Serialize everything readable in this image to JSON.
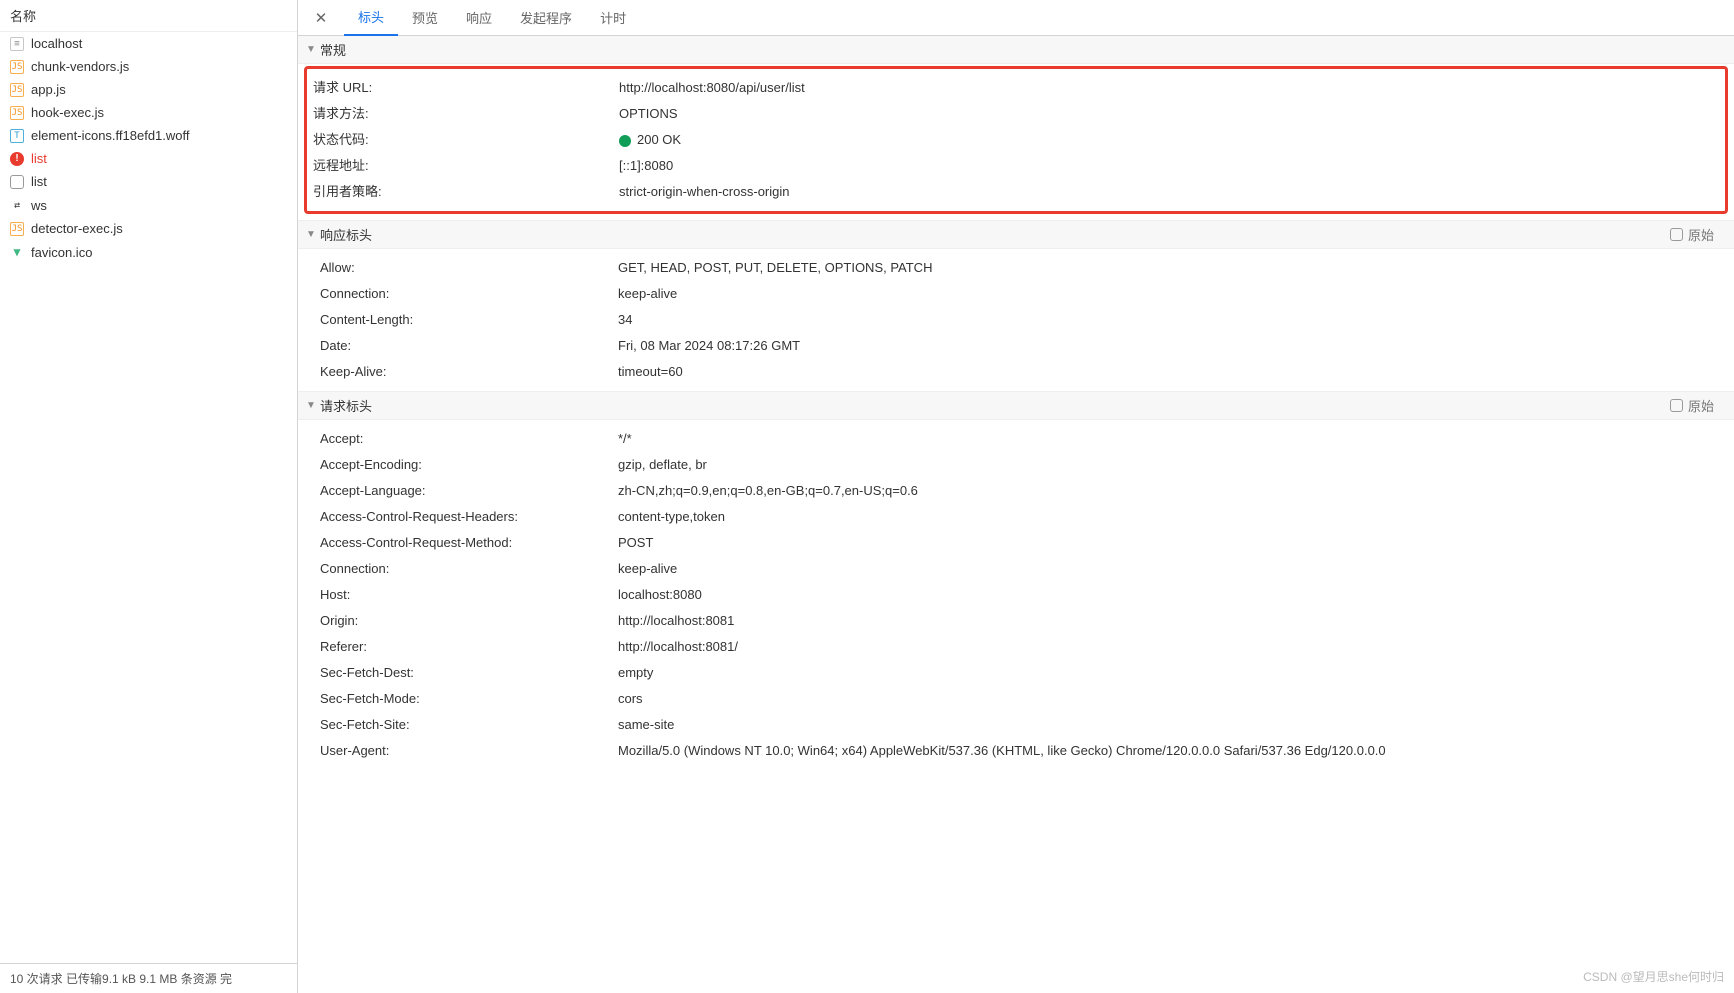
{
  "sidebar": {
    "header": "名称",
    "items": [
      {
        "name": "localhost",
        "iconType": "doc",
        "glyph": "≡"
      },
      {
        "name": "chunk-vendors.js",
        "iconType": "js",
        "glyph": "JS"
      },
      {
        "name": "app.js",
        "iconType": "js",
        "glyph": "JS"
      },
      {
        "name": "hook-exec.js",
        "iconType": "js",
        "glyph": "JS"
      },
      {
        "name": "element-icons.ff18efd1.woff",
        "iconType": "font",
        "glyph": "T"
      },
      {
        "name": "list",
        "iconType": "err",
        "glyph": "!",
        "error": true
      },
      {
        "name": "list",
        "iconType": "empty",
        "glyph": ""
      },
      {
        "name": "ws",
        "iconType": "ws",
        "glyph": "⇄"
      },
      {
        "name": "detector-exec.js",
        "iconType": "js",
        "glyph": "JS"
      },
      {
        "name": "favicon.ico",
        "iconType": "fav",
        "glyph": "▼"
      }
    ],
    "statusBar": "10 次请求  已传输9.1 kB  9.1 MB 条资源  完"
  },
  "tabs": {
    "items": [
      "标头",
      "预览",
      "响应",
      "发起程序",
      "计时"
    ],
    "activeIndex": 0
  },
  "sections": {
    "generalTitle": "常规",
    "responseTitle": "响应标头",
    "requestTitle": "请求标头",
    "rawLabel": "原始"
  },
  "general": [
    {
      "k": "请求 URL:",
      "v": "http://localhost:8080/api/user/list"
    },
    {
      "k": "请求方法:",
      "v": "OPTIONS"
    },
    {
      "k": "状态代码:",
      "v": "200 OK",
      "statusDot": true
    },
    {
      "k": "远程地址:",
      "v": "[::1]:8080"
    },
    {
      "k": "引用者策略:",
      "v": "strict-origin-when-cross-origin"
    }
  ],
  "responseHeaders": [
    {
      "k": "Allow:",
      "v": "GET, HEAD, POST, PUT, DELETE, OPTIONS, PATCH"
    },
    {
      "k": "Connection:",
      "v": "keep-alive"
    },
    {
      "k": "Content-Length:",
      "v": "34"
    },
    {
      "k": "Date:",
      "v": "Fri, 08 Mar 2024 08:17:26 GMT"
    },
    {
      "k": "Keep-Alive:",
      "v": "timeout=60"
    }
  ],
  "requestHeaders": [
    {
      "k": "Accept:",
      "v": "*/*"
    },
    {
      "k": "Accept-Encoding:",
      "v": "gzip, deflate, br"
    },
    {
      "k": "Accept-Language:",
      "v": "zh-CN,zh;q=0.9,en;q=0.8,en-GB;q=0.7,en-US;q=0.6"
    },
    {
      "k": "Access-Control-Request-Headers:",
      "v": "content-type,token"
    },
    {
      "k": "Access-Control-Request-Method:",
      "v": "POST"
    },
    {
      "k": "Connection:",
      "v": "keep-alive"
    },
    {
      "k": "Host:",
      "v": "localhost:8080"
    },
    {
      "k": "Origin:",
      "v": "http://localhost:8081"
    },
    {
      "k": "Referer:",
      "v": "http://localhost:8081/"
    },
    {
      "k": "Sec-Fetch-Dest:",
      "v": "empty"
    },
    {
      "k": "Sec-Fetch-Mode:",
      "v": "cors"
    },
    {
      "k": "Sec-Fetch-Site:",
      "v": "same-site"
    },
    {
      "k": "User-Agent:",
      "v": "Mozilla/5.0 (Windows NT 10.0; Win64; x64) AppleWebKit/537.36 (KHTML, like Gecko) Chrome/120.0.0.0 Safari/537.36 Edg/120.0.0.0"
    }
  ],
  "watermark": "CSDN @望月思she何时归"
}
